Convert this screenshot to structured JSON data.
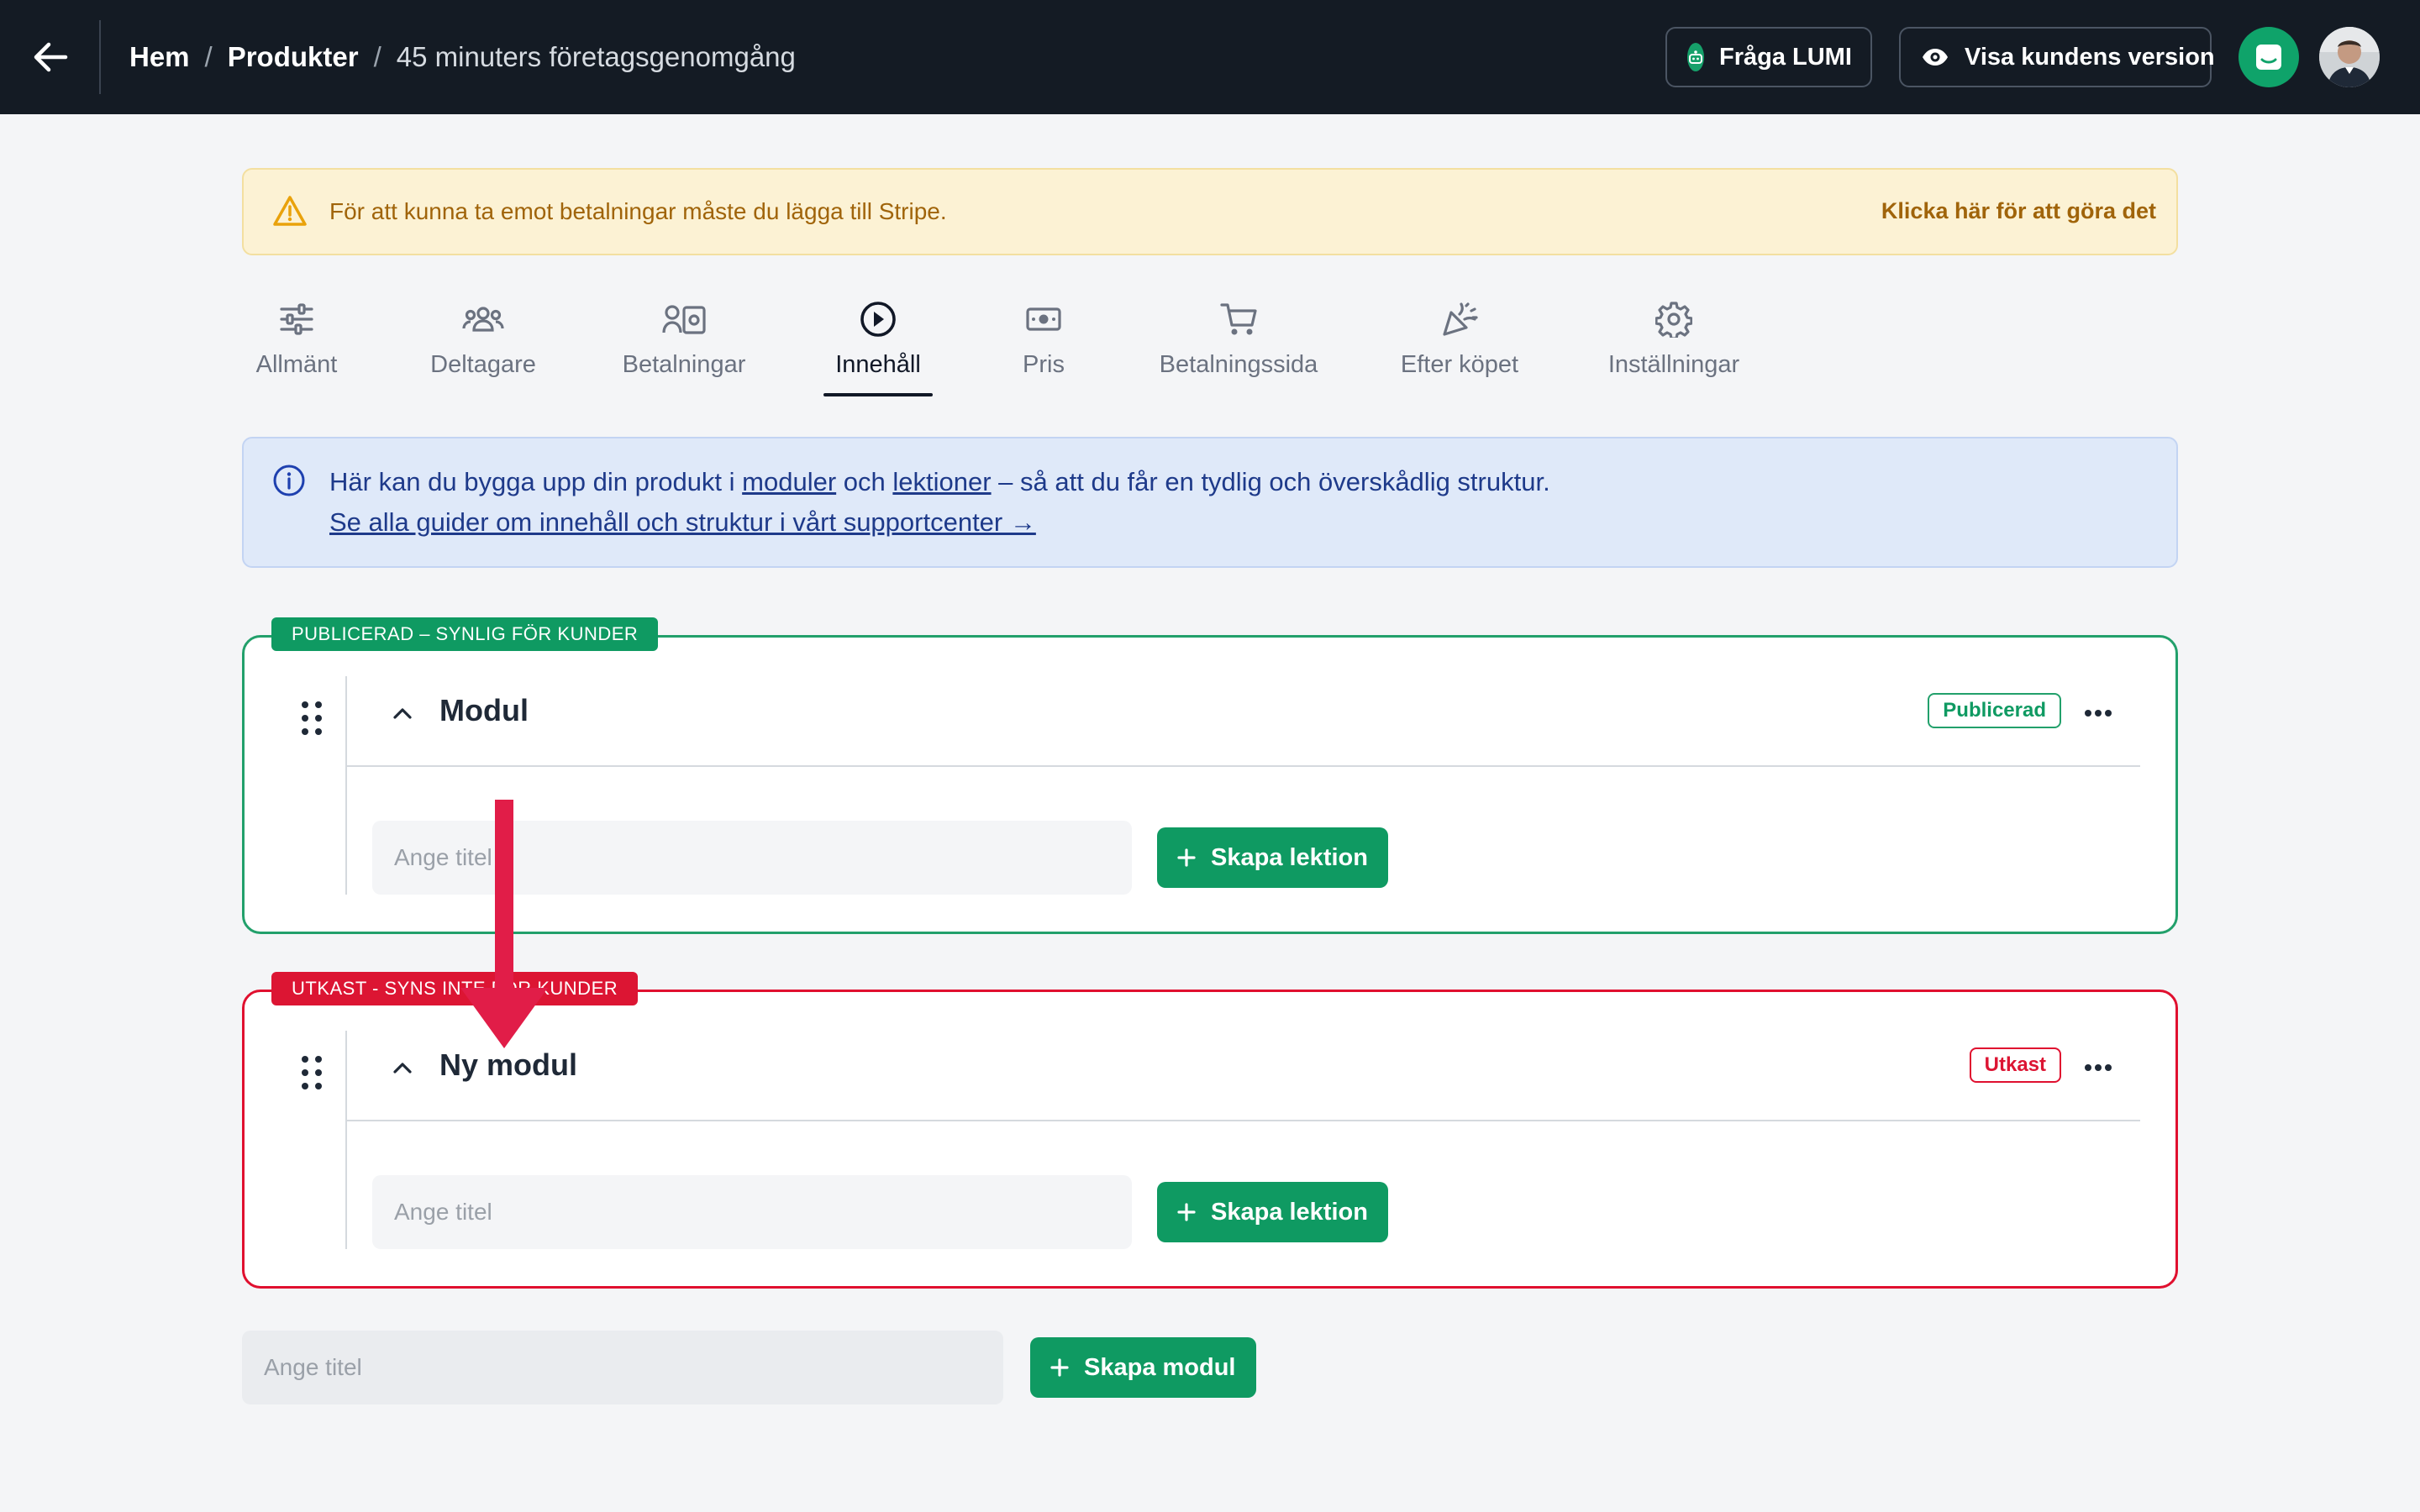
{
  "header": {
    "back_icon": "arrow-left-icon",
    "breadcrumb": {
      "home": "Hem",
      "separator": "/",
      "products": "Produkter",
      "current": "45 minuters företagsgenomgång"
    },
    "ask_lumi_label": "Fråga LUMI",
    "customer_view_label": "Visa kundens version",
    "chat_icon": "chat-icon",
    "accent_color": "#0f9a62"
  },
  "warning_banner": {
    "icon": "warning-triangle-icon",
    "text": "För att kunna ta emot betalningar måste du lägga till Stripe.",
    "action": "Klicka här för att göra det"
  },
  "tabs": [
    {
      "label": "Allmänt",
      "icon": "sliders-icon"
    },
    {
      "label": "Deltagare",
      "icon": "users-icon"
    },
    {
      "label": "Betalningar",
      "icon": "payments-icon"
    },
    {
      "label": "Innehåll",
      "icon": "play-circle-icon",
      "active": true
    },
    {
      "label": "Pris",
      "icon": "banknote-icon"
    },
    {
      "label": "Betalningssida",
      "icon": "cart-icon"
    },
    {
      "label": "Efter köpet",
      "icon": "party-popper-icon"
    },
    {
      "label": "Inställningar",
      "icon": "gear-icon"
    }
  ],
  "info_banner": {
    "icon": "info-icon",
    "text_before": "Här kan du bygga upp din produkt i ",
    "link_modules": "moduler",
    "text_and": " och ",
    "link_lessons": "lektioner",
    "text_after": " – så att du får en tydlig och överskådlig struktur.",
    "guide_link": "Se alla guider om innehåll och struktur i vårt supportcenter →"
  },
  "modules": [
    {
      "ribbon": "PUBLICERAD – SYNLIG FÖR KUNDER",
      "title": "Modul",
      "status": "Publicerad",
      "lesson_placeholder": "Ange titel",
      "create_lesson_label": "Skapa lektion",
      "color": "#0f9a62"
    },
    {
      "ribbon": "UTKAST - SYNS INTE FÖR KUNDER",
      "title": "Ny modul",
      "status": "Utkast",
      "lesson_placeholder": "Ange titel",
      "create_lesson_label": "Skapa lektion",
      "color": "#dc1533"
    }
  ],
  "new_module": {
    "placeholder": "Ange titel",
    "create_label": "Skapa modul"
  },
  "annotation": {
    "type": "arrow-down",
    "color": "#e11d48"
  }
}
